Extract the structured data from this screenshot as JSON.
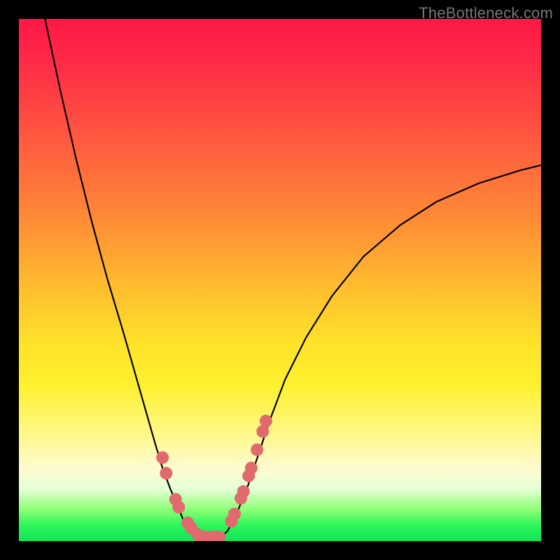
{
  "watermark": "TheBottleneck.com",
  "chart_data": {
    "type": "line",
    "title": "",
    "xlabel": "",
    "ylabel": "",
    "xlim": [
      0,
      100
    ],
    "ylim": [
      0,
      100
    ],
    "grid": false,
    "legend": false,
    "series": [
      {
        "name": "left-branch",
        "x": [
          5,
          8,
          11,
          14,
          17,
          20,
          22,
          24,
          26,
          27.5,
          29,
          30.5,
          31.5,
          32.5,
          33.5,
          34.5
        ],
        "y": [
          100,
          86,
          73,
          61,
          50,
          40,
          33,
          26,
          19,
          14,
          10,
          6.5,
          4,
          2.5,
          1.3,
          0.5
        ]
      },
      {
        "name": "valley-floor",
        "x": [
          34.5,
          35.5,
          36.5,
          37.5,
          38.5
        ],
        "y": [
          0.5,
          0.2,
          0.2,
          0.2,
          0.5
        ]
      },
      {
        "name": "right-branch",
        "x": [
          38.5,
          40,
          42,
          44,
          46,
          48,
          51,
          55,
          60,
          66,
          73,
          80,
          88,
          96,
          100
        ],
        "y": [
          0.5,
          2,
          6,
          11,
          17,
          23,
          31,
          39,
          47,
          54.5,
          60.5,
          65,
          68.5,
          71,
          72
        ]
      }
    ],
    "scatter": {
      "name": "highlight-dots",
      "color": "#e06a6e",
      "radius_px": 9,
      "points": [
        {
          "x": 27.5,
          "y": 16
        },
        {
          "x": 28.2,
          "y": 13
        },
        {
          "x": 30.0,
          "y": 8
        },
        {
          "x": 30.6,
          "y": 6.5
        },
        {
          "x": 32.3,
          "y": 3.5
        },
        {
          "x": 33.0,
          "y": 2.5
        },
        {
          "x": 34.3,
          "y": 1.2
        },
        {
          "x": 35.0,
          "y": 0.8
        },
        {
          "x": 35.6,
          "y": 0.8
        },
        {
          "x": 37.0,
          "y": 0.8
        },
        {
          "x": 37.7,
          "y": 0.8
        },
        {
          "x": 38.4,
          "y": 0.8
        },
        {
          "x": 40.7,
          "y": 3.8
        },
        {
          "x": 41.3,
          "y": 5.2
        },
        {
          "x": 42.5,
          "y": 8.2
        },
        {
          "x": 43.0,
          "y": 9.5
        },
        {
          "x": 44.0,
          "y": 12.5
        },
        {
          "x": 44.5,
          "y": 14.0
        },
        {
          "x": 45.6,
          "y": 17.5
        },
        {
          "x": 46.7,
          "y": 21.0
        },
        {
          "x": 47.3,
          "y": 23.0
        }
      ]
    }
  }
}
